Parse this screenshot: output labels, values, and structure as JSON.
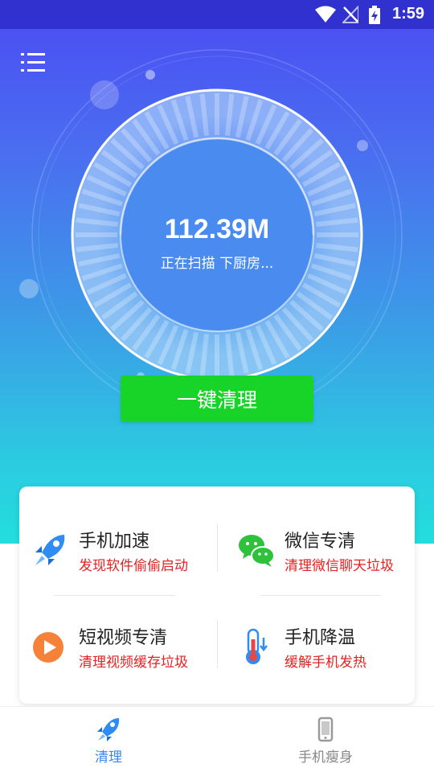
{
  "status_bar": {
    "time": "1:59"
  },
  "scanner": {
    "size": "112.39M",
    "status": "正在扫描 下厨房..."
  },
  "clean_button": {
    "label": "一键清理"
  },
  "features": [
    {
      "title": "手机加速",
      "subtitle": "发现软件偷偷启动",
      "icon": "rocket-icon"
    },
    {
      "title": "微信专清",
      "subtitle": "清理微信聊天垃圾",
      "icon": "wechat-icon"
    },
    {
      "title": "短视频专清",
      "subtitle": "清理视频缓存垃圾",
      "icon": "play-icon"
    },
    {
      "title": "手机降温",
      "subtitle": "缓解手机发热",
      "icon": "thermometer-icon"
    }
  ],
  "bottom_nav": [
    {
      "label": "清理",
      "icon": "rocket-icon",
      "active": true
    },
    {
      "label": "手机瘦身",
      "icon": "phone-icon",
      "active": false
    }
  ],
  "colors": {
    "accent_blue": "#3a86f2",
    "button_green": "#19d428",
    "subtitle_red": "#e62222",
    "inactive_gray": "#888888"
  }
}
